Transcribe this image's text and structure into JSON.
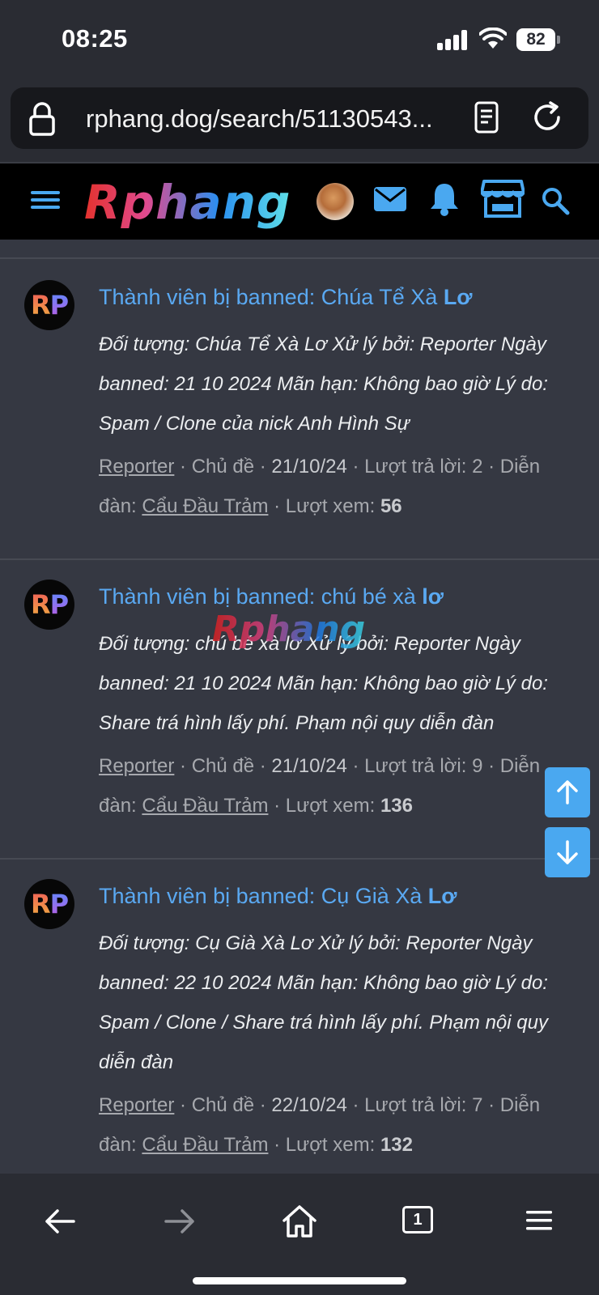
{
  "status_bar": {
    "time": "08:25",
    "battery": "82"
  },
  "browser": {
    "url": "rphang.dog/search/51130543...",
    "tab_count": "1"
  },
  "site": {
    "logo": "Rphang",
    "watermark": "Rphang"
  },
  "posts": [
    {
      "title_prefix": "Thành viên bị banned: Chúa Tể Xà ",
      "title_bold": "Lơ",
      "snippet": "Đối tượng: Chúa Tể Xà Lơ Xử lý bởi: Reporter Ngày banned: 21 10 2024 Mãn hạn: Không bao giờ Lý do: Spam / Clone của nick Anh Hình Sự",
      "author": "Reporter",
      "meta_type": " · Chủ đề · ",
      "date": "21/10/24",
      "replies": " · Lượt trả lời: 2 · Diễn đàn: ",
      "forum": "Cẩu Đầu Trảm",
      "views_label": " · Lượt xem: ",
      "views": "56"
    },
    {
      "title_prefix": "Thành viên bị banned: chú bé xà ",
      "title_bold": "lơ",
      "snippet": "Đối tượng: chú bé xà lơ Xử lý bởi: Reporter Ngày banned: 21 10 2024 Mãn hạn: Không bao giờ Lý do: Share trá hình lấy phí. Phạm nội quy diễn đàn",
      "author": "Reporter",
      "meta_type": " · Chủ đề · ",
      "date": "21/10/24",
      "replies": " · Lượt trả lời: 9 · Diễn đàn: ",
      "forum": "Cẩu Đầu Trảm",
      "views_label": " · Lượt xem: ",
      "views": "136"
    },
    {
      "title_prefix": "Thành viên bị banned: Cụ Già Xà ",
      "title_bold": "Lơ",
      "snippet": "Đối tượng: Cụ Già Xà Lơ Xử lý bởi: Reporter Ngày banned: 22 10 2024 Mãn hạn: Không bao giờ Lý do: Spam / Clone / Share trá hình lấy phí. Phạm nội quy diễn đàn",
      "author": "Reporter",
      "meta_type": " · Chủ đề · ",
      "date": "22/10/24",
      "replies": " · Lượt trả lời: 7 · Diễn đàn: ",
      "forum": "Cẩu Đầu Trảm",
      "views_label": " · Lượt xem: ",
      "views": "132"
    }
  ],
  "avatar_text": {
    "r": "R",
    "p": "P"
  },
  "colors": {
    "accent": "#5aa9f2",
    "background": "#353842",
    "header": "#000000",
    "scroll_button": "#4aa8f0"
  },
  "icons": [
    "lock-icon",
    "reader-icon",
    "reload-icon",
    "menu-icon",
    "mail-icon",
    "bell-icon",
    "store-icon",
    "search-icon",
    "arrow-up-icon",
    "arrow-down-icon",
    "back-icon",
    "forward-icon",
    "home-icon",
    "tabs-icon",
    "more-menu-icon"
  ]
}
